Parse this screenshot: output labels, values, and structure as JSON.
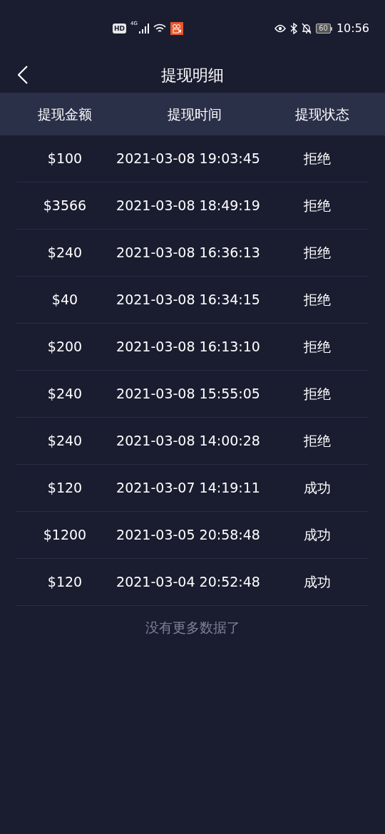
{
  "status_bar": {
    "hd": "HD",
    "network": "4G",
    "battery": "60",
    "time": "10:56"
  },
  "header": {
    "title": "提现明细"
  },
  "table": {
    "columns": [
      "提现金额",
      "提现时间",
      "提现状态"
    ],
    "rows": [
      {
        "amount": "$100",
        "time": "2021-03-08 19:03:45",
        "status": "拒绝"
      },
      {
        "amount": "$3566",
        "time": "2021-03-08 18:49:19",
        "status": "拒绝"
      },
      {
        "amount": "$240",
        "time": "2021-03-08 16:36:13",
        "status": "拒绝"
      },
      {
        "amount": "$40",
        "time": "2021-03-08 16:34:15",
        "status": "拒绝"
      },
      {
        "amount": "$200",
        "time": "2021-03-08 16:13:10",
        "status": "拒绝"
      },
      {
        "amount": "$240",
        "time": "2021-03-08 15:55:05",
        "status": "拒绝"
      },
      {
        "amount": "$240",
        "time": "2021-03-08 14:00:28",
        "status": "拒绝"
      },
      {
        "amount": "$120",
        "time": "2021-03-07 14:19:11",
        "status": "成功"
      },
      {
        "amount": "$1200",
        "time": "2021-03-05 20:58:48",
        "status": "成功"
      },
      {
        "amount": "$120",
        "time": "2021-03-04 20:52:48",
        "status": "成功"
      }
    ]
  },
  "footer": "没有更多数据了"
}
